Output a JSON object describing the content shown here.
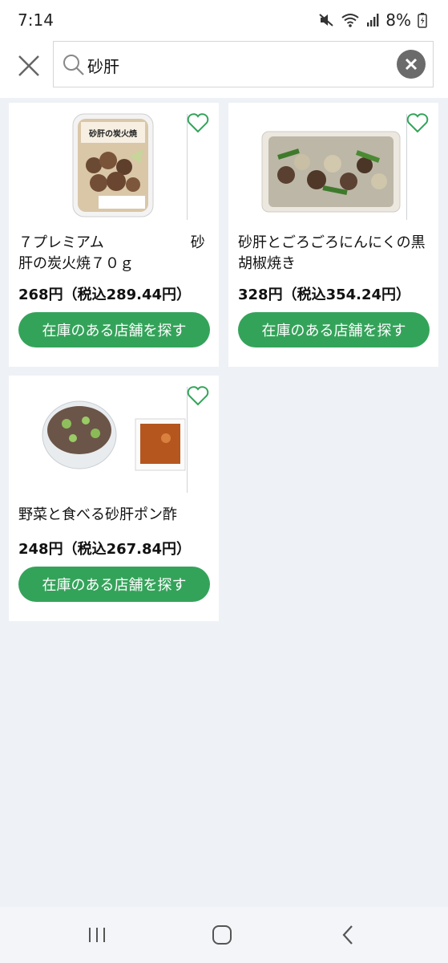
{
  "status_bar": {
    "time": "7:14",
    "battery": "8%",
    "icons": [
      "mute-icon",
      "wifi-icon",
      "signal-icon",
      "battery-charging-icon"
    ]
  },
  "search": {
    "query": "砂肝",
    "icons": [
      "close-icon",
      "search-icon",
      "clear-icon"
    ]
  },
  "products": [
    {
      "name": "７プレミアム　　　　　　砂肝の炭火焼７０ｇ",
      "price": "268円（税込289.44円）",
      "button_label": "在庫のある店舗を探す",
      "image_text": "砂肝の炭火焼"
    },
    {
      "name": "砂肝とごろごろにんにくの黒胡椒焼き",
      "price": "328円（税込354.24円）",
      "button_label": "在庫のある店舗を探す"
    },
    {
      "name": "野菜と食べる砂肝ポン酢",
      "price": "248円（税込267.84円）",
      "button_label": "在庫のある店舗を探す"
    }
  ],
  "colors": {
    "accent_green": "#34a35a",
    "background": "#eef1f6",
    "heart_outline": "#34a35a"
  },
  "nav_bar": {
    "icons": [
      "recent-apps-icon",
      "home-icon",
      "back-icon"
    ]
  }
}
